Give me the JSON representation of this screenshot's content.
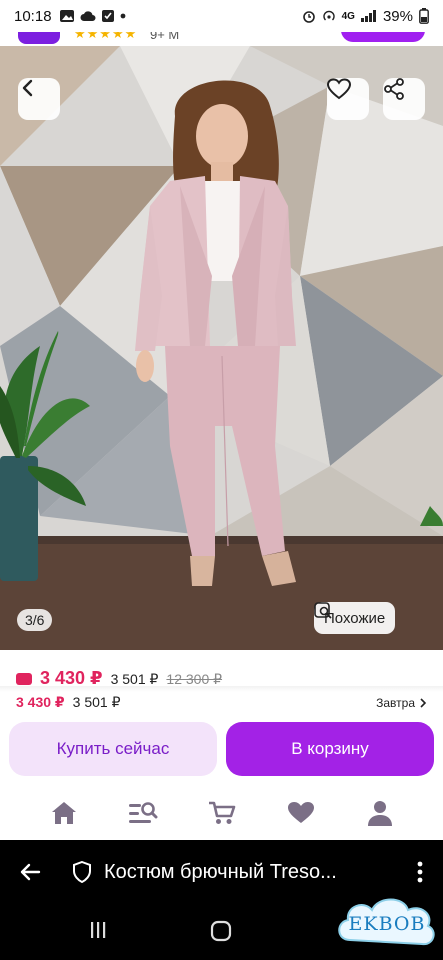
{
  "status_bar": {
    "time": "10:18",
    "battery": "39%",
    "network": "4G"
  },
  "app_header_peek": {
    "rating_text": "9+ M"
  },
  "gallery": {
    "counter": "3/6",
    "similar_label": "Похожие"
  },
  "prices": {
    "main": "3 430 ₽",
    "alt": "3 501 ₽",
    "old": "12 300 ₽",
    "row2_main": "3 430 ₽",
    "row2_alt": "3 501 ₽",
    "delivery": "Завтра"
  },
  "actions": {
    "buy_now": "Купить сейчас",
    "to_cart": "В корзину"
  },
  "tabbar": {
    "items": [
      "home-icon",
      "catalog-search-icon",
      "cart-icon",
      "favorites-icon",
      "profile-icon"
    ]
  },
  "webview": {
    "title": "Костюм брючный Treso..."
  },
  "watermark": {
    "text": "EKBOB"
  },
  "colors": {
    "accent": "#a322e6",
    "price": "#e0245e"
  }
}
